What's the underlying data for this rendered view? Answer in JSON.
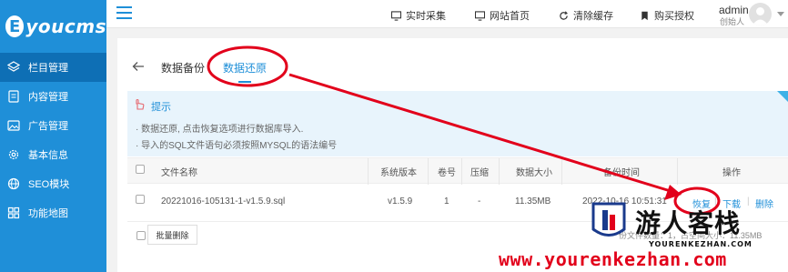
{
  "brand": {
    "logo_letter": "E",
    "logo_text": "youcms"
  },
  "sidebar": {
    "items": [
      {
        "label": "栏目管理",
        "icon": "layers-icon",
        "active": true
      },
      {
        "label": "内容管理",
        "icon": "document-icon",
        "active": false
      },
      {
        "label": "广告管理",
        "icon": "image-icon",
        "active": false
      },
      {
        "label": "基本信息",
        "icon": "gear-icon",
        "active": false
      },
      {
        "label": "SEO模块",
        "icon": "globe-icon",
        "active": false
      },
      {
        "label": "功能地图",
        "icon": "grid-icon",
        "active": false
      }
    ]
  },
  "topbar": {
    "links": [
      {
        "label": "实时采集",
        "icon": "monitor-icon"
      },
      {
        "label": "网站首页",
        "icon": "monitor-icon"
      },
      {
        "label": "清除缓存",
        "icon": "refresh-icon"
      },
      {
        "label": "购买授权",
        "icon": "bookmark-icon"
      }
    ],
    "user": {
      "name": "admin",
      "role": "创始人"
    }
  },
  "tabs": {
    "backup": "数据备份",
    "restore": "数据还原"
  },
  "tips": {
    "title": "提示",
    "lines": [
      "· 数据还原, 点击恢复选项进行数据库导入.",
      "· 导入的SQL文件语句必须按照MYSQL的语法编号"
    ]
  },
  "table": {
    "headers": [
      "文件名称",
      "系统版本",
      "卷号",
      "压缩",
      "数据大小",
      "备份时间",
      "操作"
    ],
    "rows": [
      {
        "filename": "20221016-105131-1-v1.5.9.sql",
        "version": "v1.5.9",
        "volume": "1",
        "compress": "-",
        "size": "11.35MB",
        "time": "2022-10-16 10:51:31",
        "actions": {
          "restore": "恢复",
          "download": "下载",
          "delete": "删除"
        }
      }
    ]
  },
  "batch_delete": "批量删除",
  "footer_info": "份文件数量：1，占空间大小：11.35MB",
  "watermark": {
    "brand": "游人客栈",
    "domain_small": "YOURENKEZHAN.COM",
    "url": "www.yourenkezhan.com"
  },
  "colors": {
    "primary": "#1f8fd8",
    "annotation": "#e2001b"
  }
}
